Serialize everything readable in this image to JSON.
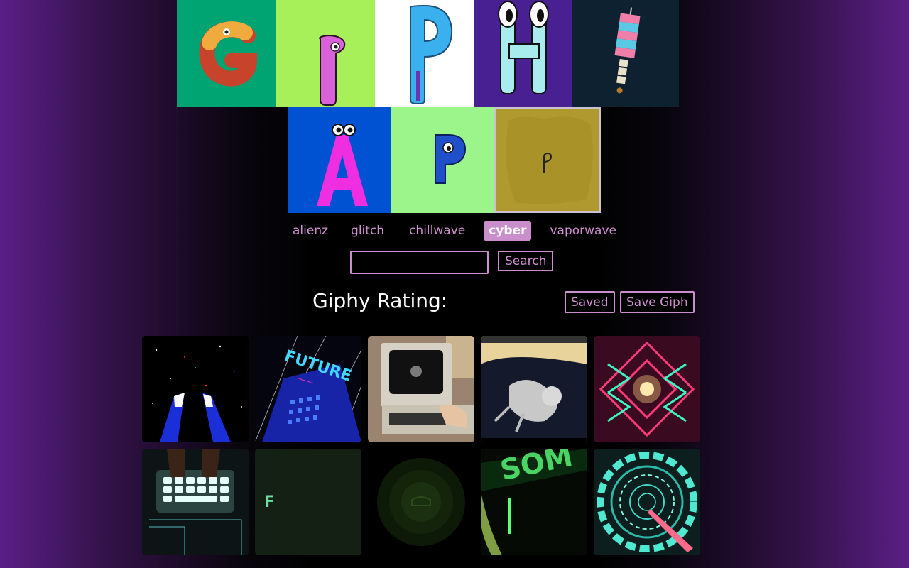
{
  "logo": {
    "letters": [
      "G",
      "I",
      "P",
      "H",
      "!",
      "A",
      "P",
      "P"
    ],
    "colors": {
      "g_bg": "#00a472",
      "i_bg": "#a7f05a",
      "p_bg": "#ffffff",
      "h_bg": "#482092",
      "exclaim_bg": "#0d2130",
      "a_bg": "#0052d3",
      "p2_bg": "#9cf58a",
      "p3_bg": "#b0992e"
    }
  },
  "topics": [
    {
      "label": "alienz",
      "active": false
    },
    {
      "label": "glitch",
      "active": false
    },
    {
      "label": "chillwave",
      "active": false
    },
    {
      "label": "cyber",
      "active": true
    },
    {
      "label": "vaporwave",
      "active": false
    }
  ],
  "search": {
    "value": "",
    "button_label": "Search"
  },
  "rating": {
    "label": "Giphy Rating:"
  },
  "actions": {
    "saved_label": "Saved",
    "save_giph_label": "Save Giph"
  },
  "gif_thumbs": {
    "future_text": "FUTURE",
    "letter_f": "F"
  },
  "theme": {
    "accent": "#c98ecb",
    "accent_text": "#cf8fd0",
    "bg": "#000000"
  }
}
